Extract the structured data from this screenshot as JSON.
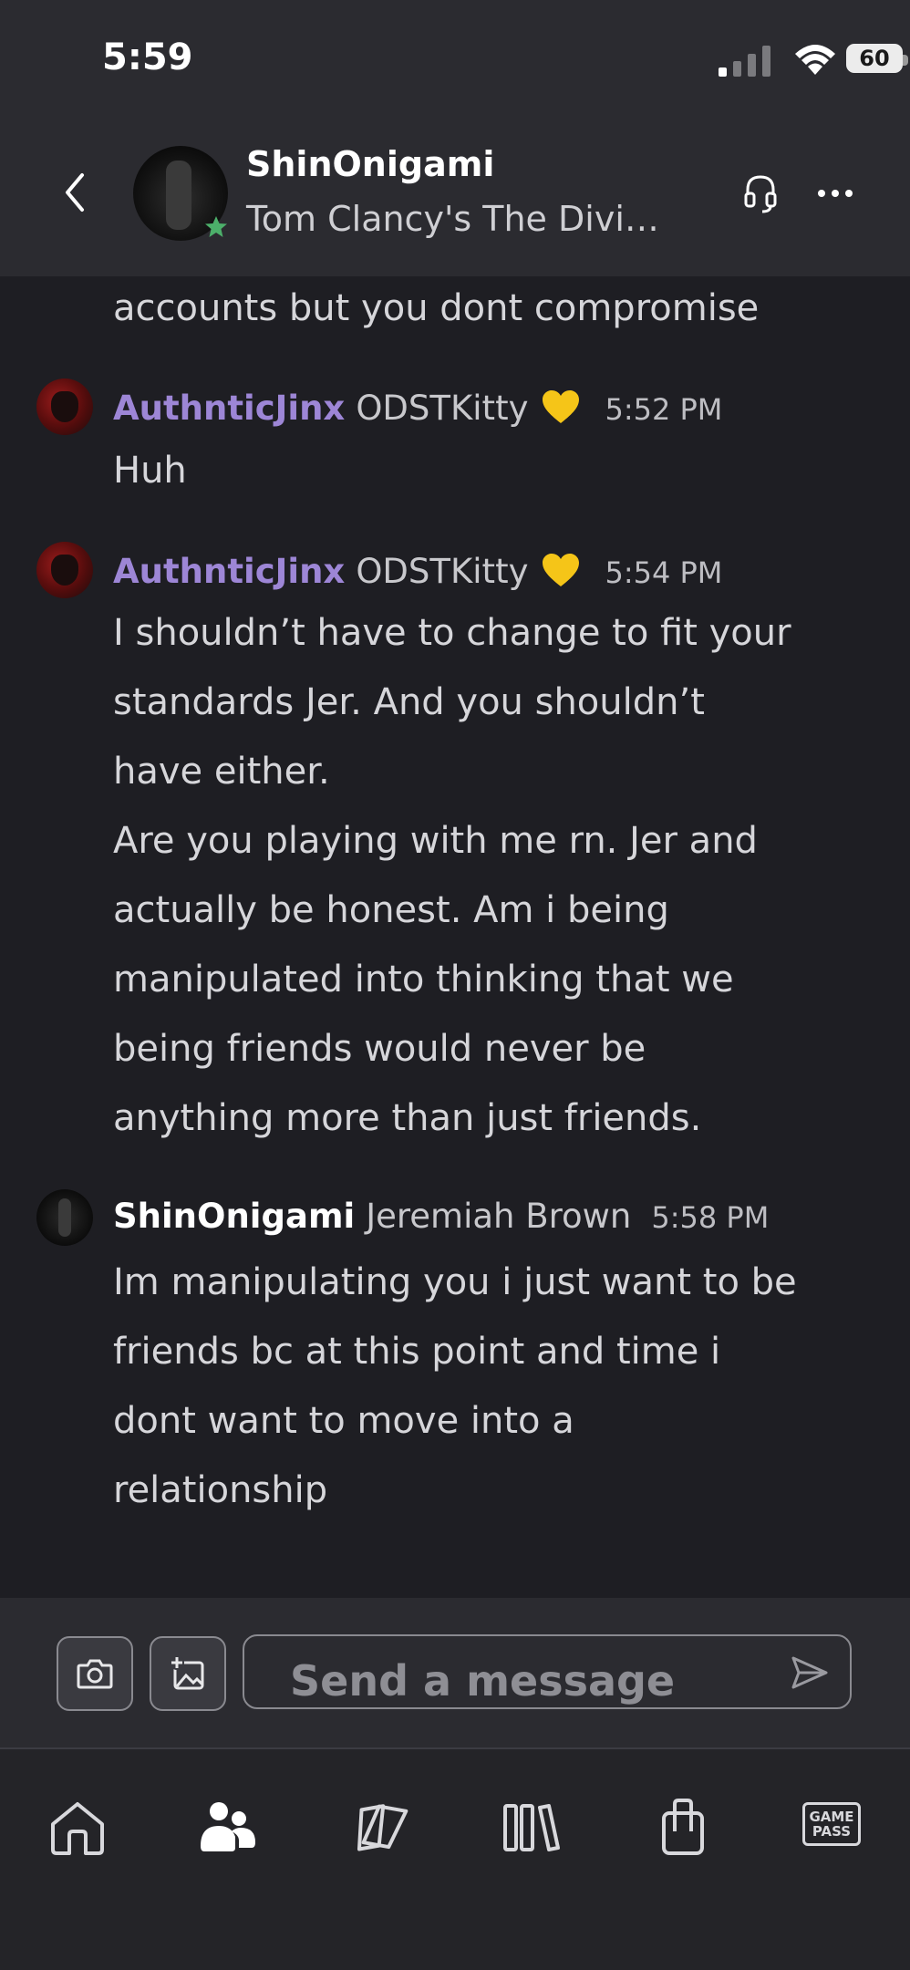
{
  "status_bar": {
    "time": "5:59",
    "battery": "60"
  },
  "header": {
    "name": "ShinOnigami",
    "subtitle": "Tom Clancy's The Divi…"
  },
  "messages": [
    {
      "lines": [
        "accounts but you dont compromise"
      ]
    },
    {
      "gamertag": "AuthnticJinx",
      "realname": "ODSTKitty",
      "time": "5:52 PM",
      "lines": [
        "Huh"
      ]
    },
    {
      "gamertag": "AuthnticJinx",
      "realname": "ODSTKitty",
      "time": "5:54 PM",
      "lines": [
        "I shouldn’t have to change to fit your",
        "standards Jer. And you shouldn’t",
        "have either.",
        "Are you playing with me rn. Jer and",
        "actually be honest. Am i being",
        "manipulated into thinking that we",
        "being friends would never be",
        "anything more than just friends."
      ]
    },
    {
      "gamertag": "ShinOnigami",
      "realname": "Jeremiah Brown",
      "time": "5:58 PM",
      "lines": [
        "Im manipulating you i just want to be",
        "friends bc at this point and time i",
        "dont want to move into a",
        "relationship"
      ]
    }
  ],
  "composer": {
    "placeholder": "Send a message"
  },
  "bottom_nav": {
    "items": [
      "home-icon",
      "people-icon",
      "social-icon",
      "library-icon",
      "store-icon",
      "game-pass-icon"
    ],
    "game_pass_label_1": "GAME",
    "game_pass_label_2": "PASS"
  },
  "colors": {
    "background": "#1e1e23",
    "header_bg": "#2b2b30",
    "gamertag_purple": "#9d86d6",
    "presence_green": "#4caf6a",
    "heart_yellow": "#f5c518"
  }
}
